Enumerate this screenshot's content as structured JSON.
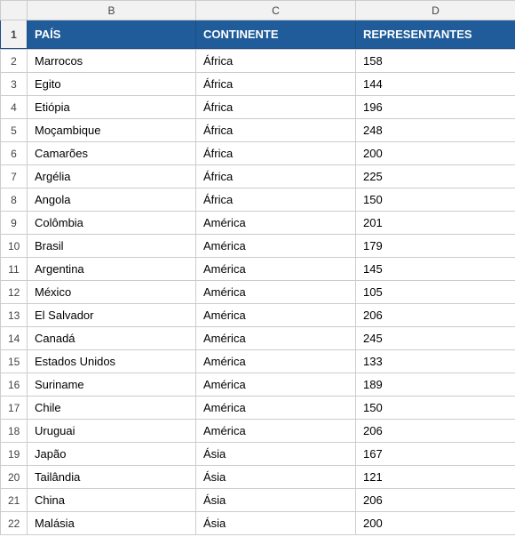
{
  "columns": {
    "b_label": "B",
    "c_label": "C",
    "d_label": "D"
  },
  "headers": {
    "pais": "PAÍS",
    "continente": "CONTINENTE",
    "representantes": "REPRESENTANTES"
  },
  "rows": [
    {
      "num": 2,
      "pais": "Marrocos",
      "continente": "África",
      "rep": "158"
    },
    {
      "num": 3,
      "pais": "Egito",
      "continente": "África",
      "rep": "144"
    },
    {
      "num": 4,
      "pais": "Etiópia",
      "continente": "África",
      "rep": "196"
    },
    {
      "num": 5,
      "pais": "Moçambique",
      "continente": "África",
      "rep": "248"
    },
    {
      "num": 6,
      "pais": "Camarões",
      "continente": "África",
      "rep": "200"
    },
    {
      "num": 7,
      "pais": "Argélia",
      "continente": "África",
      "rep": "225"
    },
    {
      "num": 8,
      "pais": "Angola",
      "continente": "África",
      "rep": "150"
    },
    {
      "num": 9,
      "pais": "Colômbia",
      "continente": "América",
      "rep": "201"
    },
    {
      "num": 10,
      "pais": "Brasil",
      "continente": "América",
      "rep": "179"
    },
    {
      "num": 11,
      "pais": "Argentina",
      "continente": "América",
      "rep": "145"
    },
    {
      "num": 12,
      "pais": "México",
      "continente": "América",
      "rep": "105"
    },
    {
      "num": 13,
      "pais": "El Salvador",
      "continente": "América",
      "rep": "206"
    },
    {
      "num": 14,
      "pais": "Canadá",
      "continente": "América",
      "rep": "245"
    },
    {
      "num": 15,
      "pais": "Estados Unidos",
      "continente": "América",
      "rep": "133"
    },
    {
      "num": 16,
      "pais": "Suriname",
      "continente": "América",
      "rep": "189"
    },
    {
      "num": 17,
      "pais": "Chile",
      "continente": "América",
      "rep": "150"
    },
    {
      "num": 18,
      "pais": "Uruguai",
      "continente": "América",
      "rep": "206"
    },
    {
      "num": 19,
      "pais": "Japão",
      "continente": "Ásia",
      "rep": "167"
    },
    {
      "num": 20,
      "pais": "Tailândia",
      "continente": "Ásia",
      "rep": "121"
    },
    {
      "num": 21,
      "pais": "China",
      "continente": "Ásia",
      "rep": "206"
    },
    {
      "num": 22,
      "pais": "Malásia",
      "continente": "Ásia",
      "rep": "200"
    }
  ]
}
